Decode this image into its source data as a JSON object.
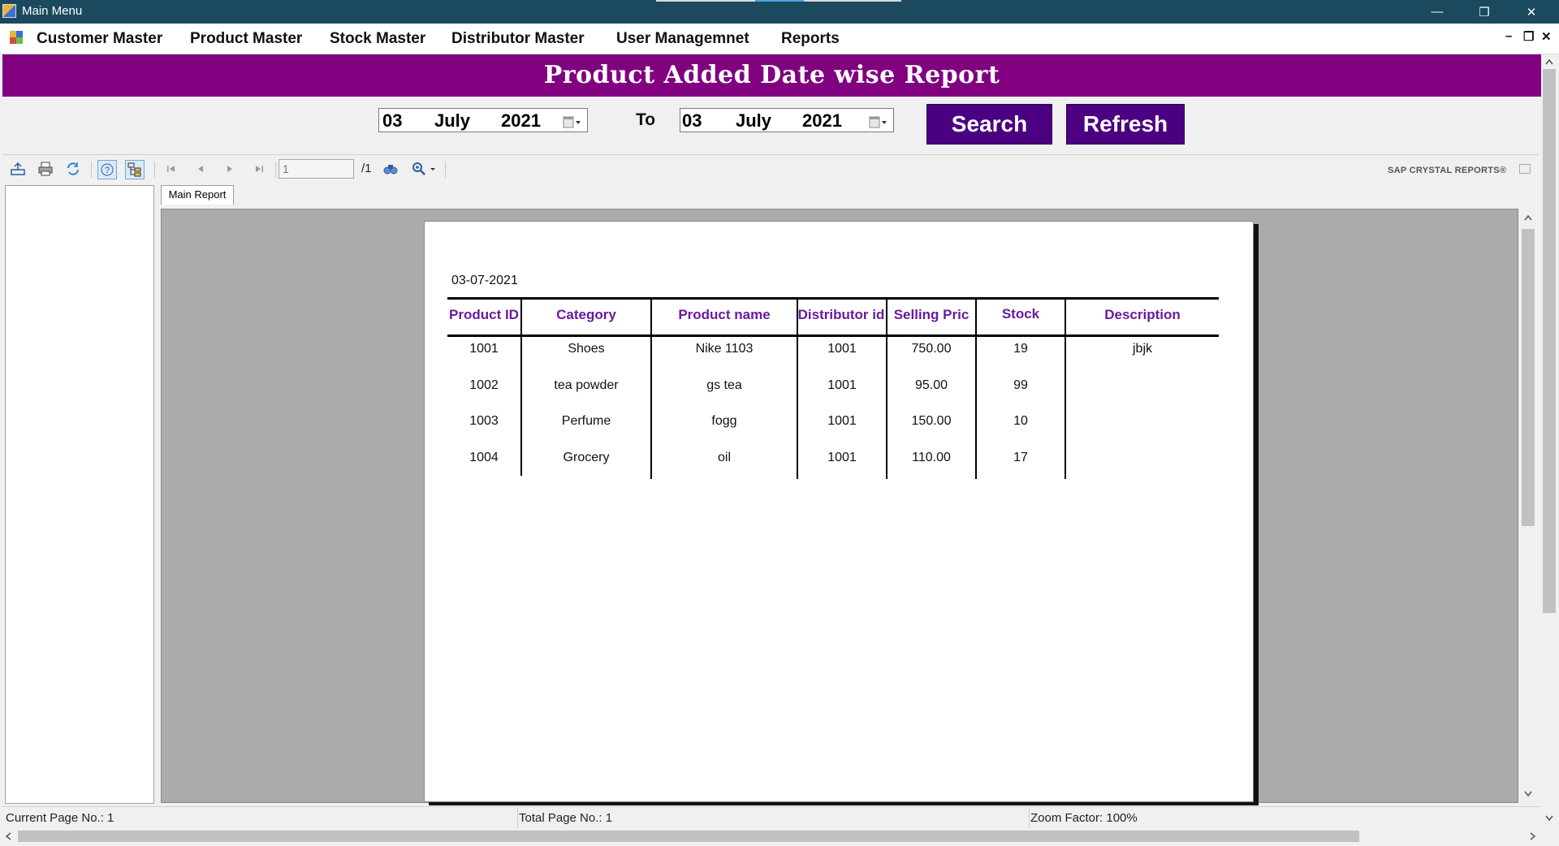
{
  "window": {
    "title": "Main Menu",
    "minimize_glyph": "—",
    "restore_glyph": "❐",
    "close_glyph": "✕"
  },
  "menu": {
    "items": [
      "Customer Master",
      "Product Master",
      "Stock Master",
      "Distributor Master",
      "User Managemnet",
      "Reports"
    ],
    "mdi_minimize": "–",
    "mdi_restore": "❐",
    "mdi_close": "✕"
  },
  "banner": {
    "title": "Product Added Date wise Report"
  },
  "filter": {
    "from": {
      "day": "03",
      "month": "July",
      "year": "2021"
    },
    "to_label": "To",
    "to": {
      "day": "03",
      "month": "July",
      "year": "2021"
    },
    "search_label": "Search",
    "refresh_label": "Refresh"
  },
  "toolbar": {
    "page_value": "1",
    "page_total": "/1",
    "brand": "SAP CRYSTAL REPORTS®",
    "icons": [
      "export-icon",
      "print-icon",
      "refresh-icon",
      "help-icon",
      "group-tree-icon",
      "first-page-icon",
      "prev-page-icon",
      "next-page-icon",
      "last-page-icon",
      "find-icon",
      "zoom-icon"
    ]
  },
  "tabs": {
    "main": "Main Report"
  },
  "report": {
    "date": "03-07-2021",
    "columns": [
      "Product ID",
      "Category",
      "Product name",
      "Distributor id",
      "Selling Pric",
      "Stock",
      "Description"
    ],
    "rows": [
      [
        "1001",
        "Shoes",
        "Nike 1103",
        "1001",
        "750.00",
        "19",
        "jbjk"
      ],
      [
        "1002",
        "tea powder",
        "gs tea",
        "1001",
        "95.00",
        "99",
        ""
      ],
      [
        "1003",
        "Perfume",
        "fogg",
        "1001",
        "150.00",
        "10",
        ""
      ],
      [
        "1004",
        "Grocery",
        "oil",
        "1001",
        "110.00",
        "17",
        ""
      ]
    ]
  },
  "status": {
    "current_page": "Current Page No.: 1",
    "total_page": "Total Page No.: 1",
    "zoom": "Zoom Factor: 100%"
  },
  "colors": {
    "banner": "#800080",
    "button": "#4b0082",
    "titlebar": "#1b4a5e",
    "header_text": "#6a1b9a"
  }
}
